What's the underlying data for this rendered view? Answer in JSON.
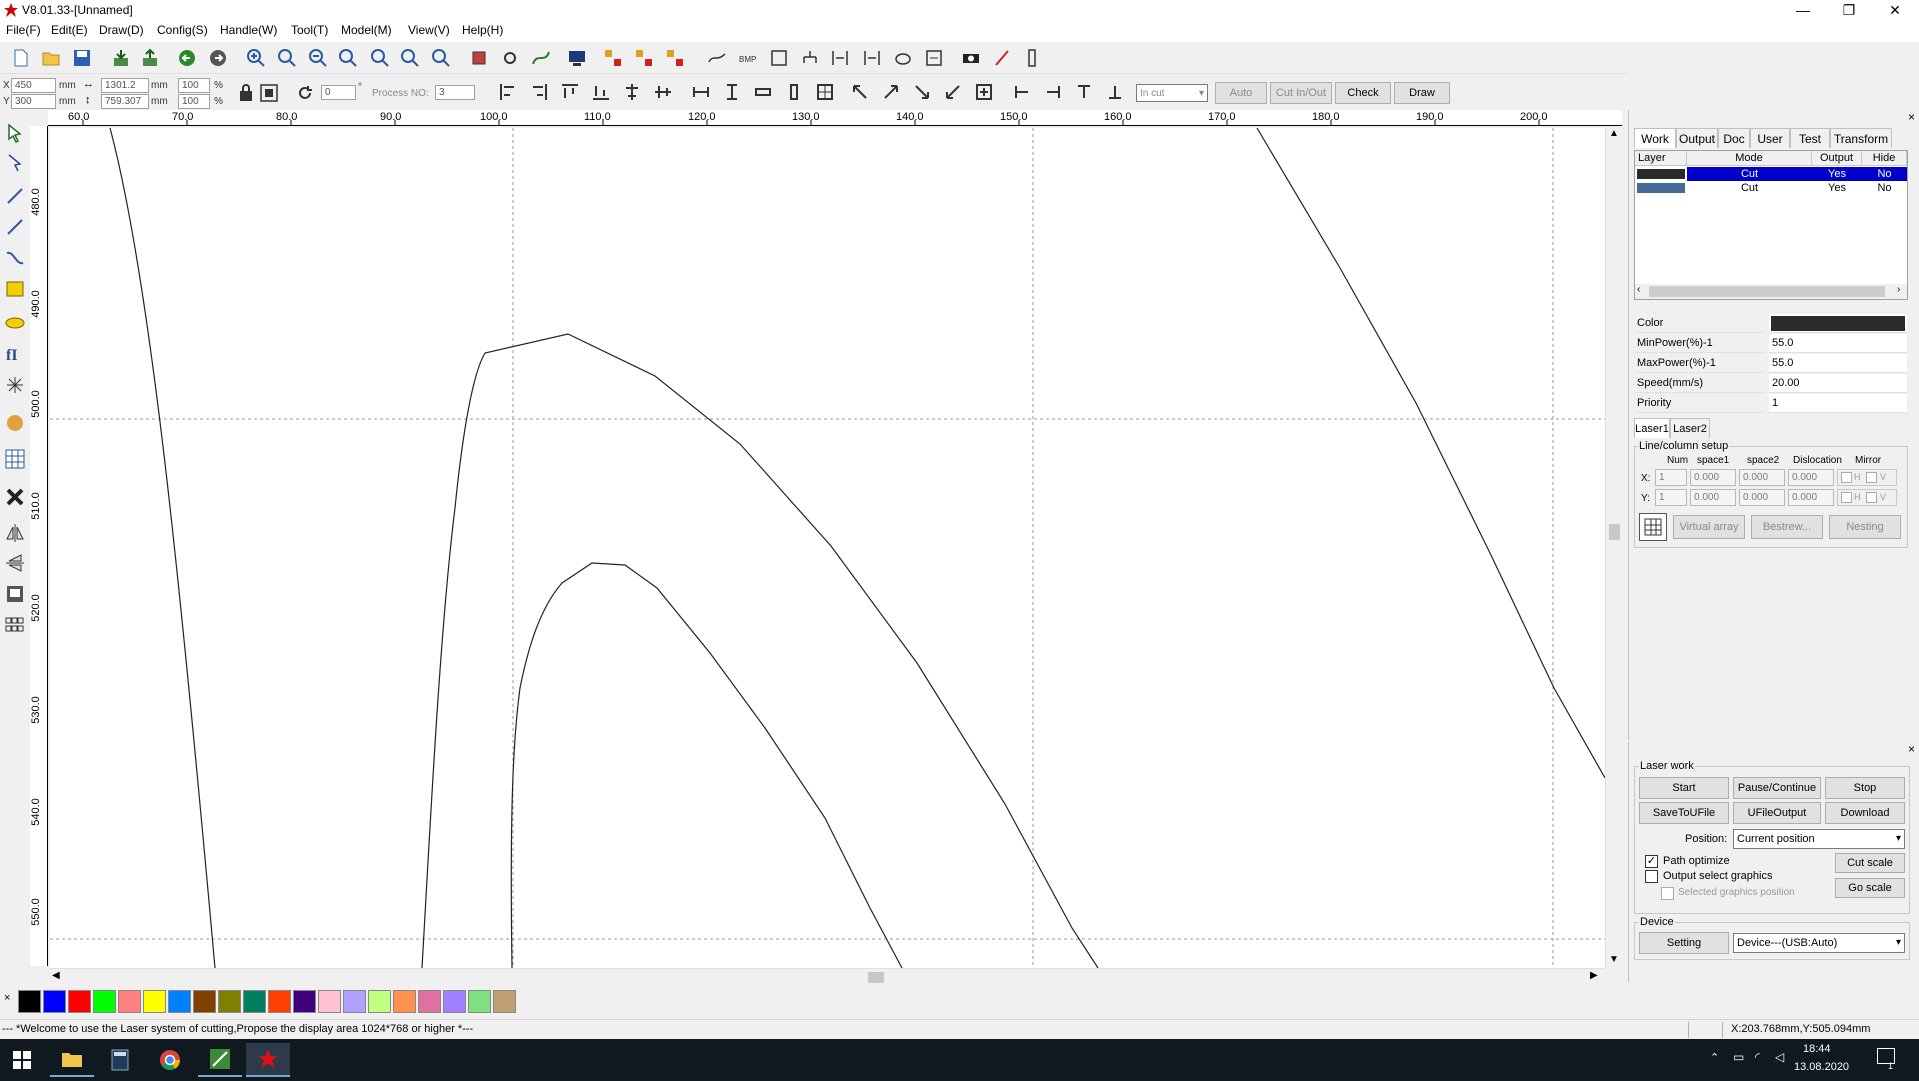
{
  "app": {
    "title": "V8.01.33-[Unnamed]"
  },
  "menu": [
    "File(F)",
    "Edit(E)",
    "Draw(D)",
    "Config(S)",
    "Handle(W)",
    "Tool(T)",
    "Model(M)",
    "View(V)",
    "Help(H)"
  ],
  "coords": {
    "x_label": "X",
    "y_label": "Y",
    "x_value": "450",
    "y_value": "300",
    "width_value": "1301.2",
    "height_value": "759.307",
    "unit": "mm",
    "scale_x": "100",
    "scale_y": "100",
    "pct": "%",
    "rotation": "0",
    "deg": "°",
    "process_label": "Process NO:",
    "process_value": "3"
  },
  "cut_controls": {
    "mode_select": "In cut",
    "auto": "Auto",
    "cut_in_out": "Cut In/Out",
    "check": "Check",
    "draw": "Draw"
  },
  "ruler": {
    "h_ticks": [
      "60.0",
      "70.0",
      "80.0",
      "90.0",
      "100.0",
      "110.0",
      "120.0",
      "130.0",
      "140.0",
      "150.0",
      "160.0",
      "170.0",
      "180.0",
      "190.0",
      "200.0"
    ],
    "v_ticks": [
      "480.0",
      "490.0",
      "500.0",
      "510.0",
      "520.0",
      "530.0",
      "540.0",
      "550.0"
    ]
  },
  "panel": {
    "tabs": [
      "Work",
      "Output",
      "Doc",
      "User",
      "Test",
      "Transform"
    ],
    "close": "×",
    "layer_headers": [
      "Layer",
      "Mode",
      "Output",
      "Hide"
    ],
    "layers": [
      {
        "mode": "Cut",
        "output": "Yes",
        "hide": "No",
        "color": "#2b2b2b",
        "selected": true
      },
      {
        "mode": "Cut",
        "output": "Yes",
        "hide": "No",
        "color": "#466a97",
        "selected": false
      }
    ],
    "props": [
      {
        "label": "Color",
        "value": ""
      },
      {
        "label": "MinPower(%)-1",
        "value": "55.0"
      },
      {
        "label": "MaxPower(%)-1",
        "value": "55.0"
      },
      {
        "label": "Speed(mm/s)",
        "value": "20.00"
      },
      {
        "label": "Priority",
        "value": "1"
      }
    ],
    "laser_tabs": [
      "Laser1",
      "Laser2"
    ],
    "array": {
      "group": "Line/column setup",
      "headers": [
        "Num",
        "space1",
        "space2",
        "Dislocation",
        "Mirror"
      ],
      "x_label": "X:",
      "y_label": "Y:",
      "x_values": [
        "1",
        "0.000",
        "0.000",
        "0.000"
      ],
      "y_values": [
        "1",
        "0.000",
        "0.000",
        "0.000"
      ],
      "h": "H",
      "v": "V",
      "buttons": [
        "Virtual array",
        "Bestrew...",
        "Nesting"
      ]
    }
  },
  "laser_work": {
    "group": "Laser work",
    "buttons": [
      "Start",
      "Pause/Continue",
      "Stop",
      "SaveToUFile",
      "UFileOutput",
      "Download"
    ],
    "position_label": "Position:",
    "position_value": "Current position",
    "path_optimize": "Path optimize",
    "output_select": "Output select graphics",
    "selected_pos": "Selected graphics position",
    "cut_scale": "Cut scale",
    "go_scale": "Go scale",
    "device_group": "Device",
    "setting": "Setting",
    "device_value": "Device---(USB:Auto)"
  },
  "palette": [
    "#000000",
    "#0000ff",
    "#ff0000",
    "#00ff00",
    "#ff8080",
    "#ffff00",
    "#0080ff",
    "#804000",
    "#808000",
    "#008060",
    "#ff4000",
    "#400080",
    "#ffc0d0",
    "#b0a0ff",
    "#c0ff80",
    "#ff9050",
    "#e070a0",
    "#a080ff",
    "#80e080",
    "#c0a070"
  ],
  "status": {
    "message": "--- *Welcome to use the Laser system of cutting,Propose the display area 1024*768 or higher *---",
    "coords": "X:203.768mm,Y:505.094mm"
  },
  "taskbar": {
    "time": "18:44",
    "date": "13.08.2020",
    "notif_count": "1"
  }
}
